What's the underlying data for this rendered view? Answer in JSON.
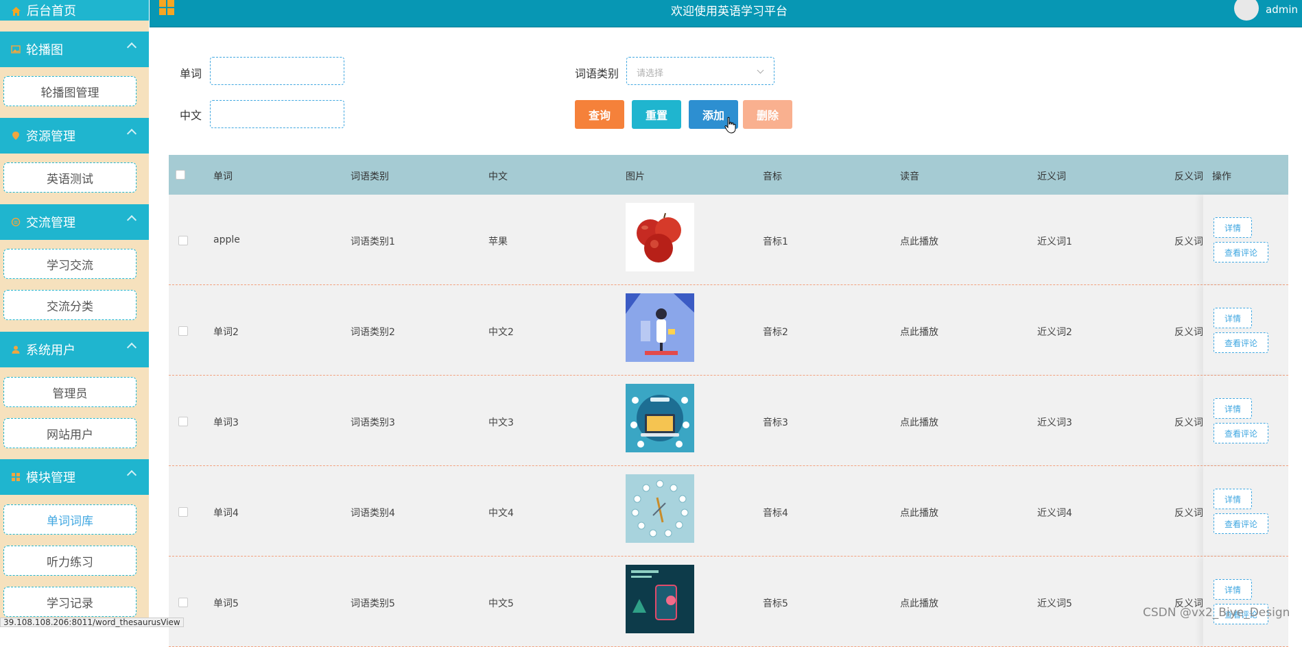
{
  "topbar": {
    "title": "欢迎使用英语学习平台",
    "username": "admin"
  },
  "sidebar": {
    "home": "后台首页",
    "groups": [
      {
        "label": "轮播图",
        "items": [
          "轮播图管理"
        ]
      },
      {
        "label": "资源管理",
        "items": [
          "英语测试"
        ]
      },
      {
        "label": "交流管理",
        "items": [
          "学习交流",
          "交流分类"
        ]
      },
      {
        "label": "系统用户",
        "items": [
          "管理员",
          "网站用户"
        ]
      },
      {
        "label": "模块管理",
        "items": [
          "单词词库",
          "听力练习",
          "学习记录"
        ]
      }
    ]
  },
  "search": {
    "word_label": "单词",
    "chinese_label": "中文",
    "category_label": "词语类别",
    "category_placeholder": "请选择",
    "buttons": {
      "query": "查询",
      "reset": "重置",
      "add": "添加",
      "delete": "删除"
    }
  },
  "table": {
    "headers": [
      "单词",
      "词语类别",
      "中文",
      "图片",
      "音标",
      "读音",
      "近义词",
      "反义词",
      "操作"
    ],
    "rows": [
      {
        "word": "apple",
        "category": "词语类别1",
        "chinese": "苹果",
        "phonetic": "音标1",
        "pronounce": "点此播放",
        "synonym": "近义词1",
        "antonym": "反义词1"
      },
      {
        "word": "单词2",
        "category": "词语类别2",
        "chinese": "中文2",
        "phonetic": "音标2",
        "pronounce": "点此播放",
        "synonym": "近义词2",
        "antonym": "反义词2"
      },
      {
        "word": "单词3",
        "category": "词语类别3",
        "chinese": "中文3",
        "phonetic": "音标3",
        "pronounce": "点此播放",
        "synonym": "近义词3",
        "antonym": "反义词3"
      },
      {
        "word": "单词4",
        "category": "词语类别4",
        "chinese": "中文4",
        "phonetic": "音标4",
        "pronounce": "点此播放",
        "synonym": "近义词4",
        "antonym": "反义词4"
      },
      {
        "word": "单词5",
        "category": "词语类别5",
        "chinese": "中文5",
        "phonetic": "音标5",
        "pronounce": "点此播放",
        "synonym": "近义词5",
        "antonym": "反义词5"
      }
    ],
    "op_detail": "详情",
    "op_comments": "查看评论"
  },
  "status_url": "39.108.108.206:8011/word_thesaurusView",
  "watermark": "CSDN @vx2_Biye_Design",
  "colors": {
    "teal": "#1fb5cf",
    "topbar": "#0797b4",
    "sidebar_bg": "#f6e1bd",
    "query": "#f5813a",
    "reset": "#1fb5cf",
    "add": "#2d8fd1",
    "delete": "#f9b08f",
    "table_head": "#a5cbd3"
  }
}
